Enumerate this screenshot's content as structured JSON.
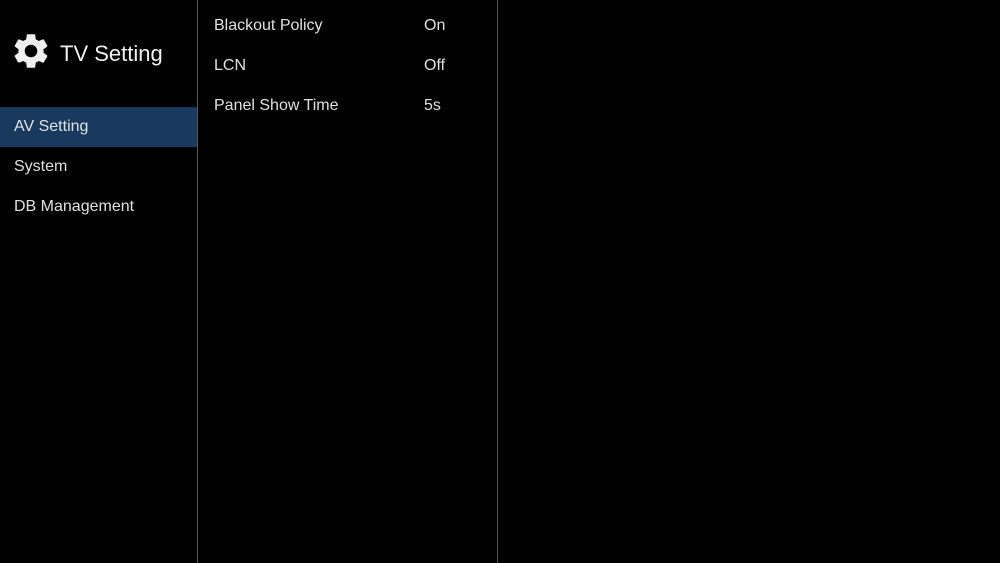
{
  "header": {
    "title": "TV Setting"
  },
  "sidebar": {
    "items": [
      {
        "label": "AV Setting",
        "active": true
      },
      {
        "label": "System",
        "active": false
      },
      {
        "label": "DB Management",
        "active": false
      }
    ]
  },
  "settings": {
    "rows": [
      {
        "label": "Blackout Policy",
        "value": "On"
      },
      {
        "label": "LCN",
        "value": "Off"
      },
      {
        "label": "Panel Show Time",
        "value": "5s"
      }
    ]
  }
}
